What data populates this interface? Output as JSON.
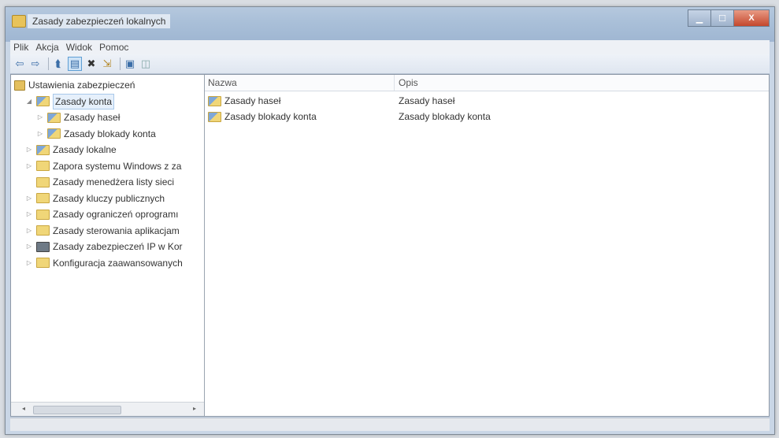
{
  "window": {
    "title": "Zasady zabezpieczeń lokalnych",
    "controls": {
      "minimize": "▁",
      "maximize": "☐",
      "close": "X"
    }
  },
  "menubar": {
    "items": [
      "Plik",
      "Akcja",
      "Widok",
      "Pomoc"
    ]
  },
  "toolbar": {
    "buttons": [
      {
        "icon": "back-arrow-icon",
        "glyph": "⇦"
      },
      {
        "icon": "forward-arrow-icon",
        "glyph": "⇨"
      },
      {
        "icon": "up-folder-icon",
        "glyph": "⮬"
      },
      {
        "icon": "show-tree-icon",
        "glyph": "▤"
      },
      {
        "icon": "delete-icon",
        "glyph": "✖"
      },
      {
        "icon": "export-list-icon",
        "glyph": "⇲"
      },
      {
        "icon": "properties-icon",
        "glyph": "▣"
      },
      {
        "icon": "help-icon",
        "glyph": "◫"
      }
    ]
  },
  "tree": {
    "items": [
      {
        "label": "Ustawienia zabezpieczeń",
        "level": 0,
        "icon": "root"
      },
      {
        "label": "Zasady konta",
        "level": 1,
        "icon": "shield",
        "expander": "◢",
        "selected": true
      },
      {
        "label": "Zasady haseł",
        "level": 2,
        "icon": "shield",
        "expander": "▷"
      },
      {
        "label": "Zasady blokady konta",
        "level": 2,
        "icon": "shield",
        "expander": "▷"
      },
      {
        "label": "Zasady lokalne",
        "level": 1,
        "icon": "shield",
        "expander": "▷"
      },
      {
        "label": "Zapora systemu Windows z za",
        "level": 1,
        "icon": "folder",
        "expander": "▷"
      },
      {
        "label": "Zasady menedżera listy sieci",
        "level": 1,
        "icon": "folder",
        "expander": ""
      },
      {
        "label": "Zasady kluczy publicznych",
        "level": 1,
        "icon": "folder",
        "expander": "▷"
      },
      {
        "label": "Zasady ograniczeń oprogramı",
        "level": 1,
        "icon": "folder",
        "expander": "▷"
      },
      {
        "label": "Zasady sterowania aplikacjam",
        "level": 1,
        "icon": "folder",
        "expander": "▷"
      },
      {
        "label": "Zasady zabezpieczeń IP w Kor",
        "level": 1,
        "icon": "net",
        "expander": "▷"
      },
      {
        "label": "Konfiguracja zaawansowanych",
        "level": 1,
        "icon": "folder",
        "expander": "▷"
      }
    ]
  },
  "list": {
    "columns": {
      "name": "Nazwa",
      "description": "Opis"
    },
    "rows": [
      {
        "name": "Zasady haseł",
        "description": "Zasady haseł"
      },
      {
        "name": "Zasady blokady konta",
        "description": "Zasady blokady konta"
      }
    ]
  },
  "scrollbar": {
    "left_arrow": "◂",
    "right_arrow": "▸"
  }
}
